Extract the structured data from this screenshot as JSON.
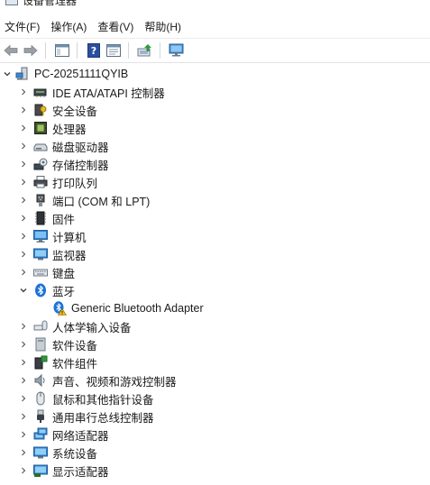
{
  "window": {
    "title": "设备管理器"
  },
  "menu": [
    {
      "label": "文件(F)"
    },
    {
      "label": "操作(A)"
    },
    {
      "label": "查看(V)"
    },
    {
      "label": "帮助(H)"
    }
  ],
  "tree": {
    "root": "PC-20251111QYIB",
    "categories": [
      {
        "label": "IDE ATA/ATAPI 控制器",
        "icon": "ide-controller-icon"
      },
      {
        "label": "安全设备",
        "icon": "security-device-icon"
      },
      {
        "label": "处理器",
        "icon": "processor-icon"
      },
      {
        "label": "磁盘驱动器",
        "icon": "disk-drive-icon"
      },
      {
        "label": "存储控制器",
        "icon": "storage-controller-icon"
      },
      {
        "label": "打印队列",
        "icon": "printer-icon"
      },
      {
        "label": "端口 (COM 和 LPT)",
        "icon": "port-icon"
      },
      {
        "label": "固件",
        "icon": "firmware-icon"
      },
      {
        "label": "计算机",
        "icon": "computer-icon"
      },
      {
        "label": "监视器",
        "icon": "monitor-icon"
      },
      {
        "label": "键盘",
        "icon": "keyboard-icon"
      },
      {
        "label": "蓝牙",
        "icon": "bluetooth-icon",
        "expanded": true,
        "children": [
          {
            "label": "Generic Bluetooth Adapter",
            "icon": "bluetooth-warning-icon"
          }
        ]
      },
      {
        "label": "人体学输入设备",
        "icon": "hid-icon"
      },
      {
        "label": "软件设备",
        "icon": "software-device-icon"
      },
      {
        "label": "软件组件",
        "icon": "software-component-icon"
      },
      {
        "label": "声音、视频和游戏控制器",
        "icon": "sound-icon"
      },
      {
        "label": "鼠标和其他指针设备",
        "icon": "mouse-icon"
      },
      {
        "label": "通用串行总线控制器",
        "icon": "usb-icon"
      },
      {
        "label": "网络适配器",
        "icon": "network-adapter-icon"
      },
      {
        "label": "系统设备",
        "icon": "system-device-icon"
      },
      {
        "label": "显示适配器",
        "icon": "display-adapter-icon"
      }
    ]
  }
}
